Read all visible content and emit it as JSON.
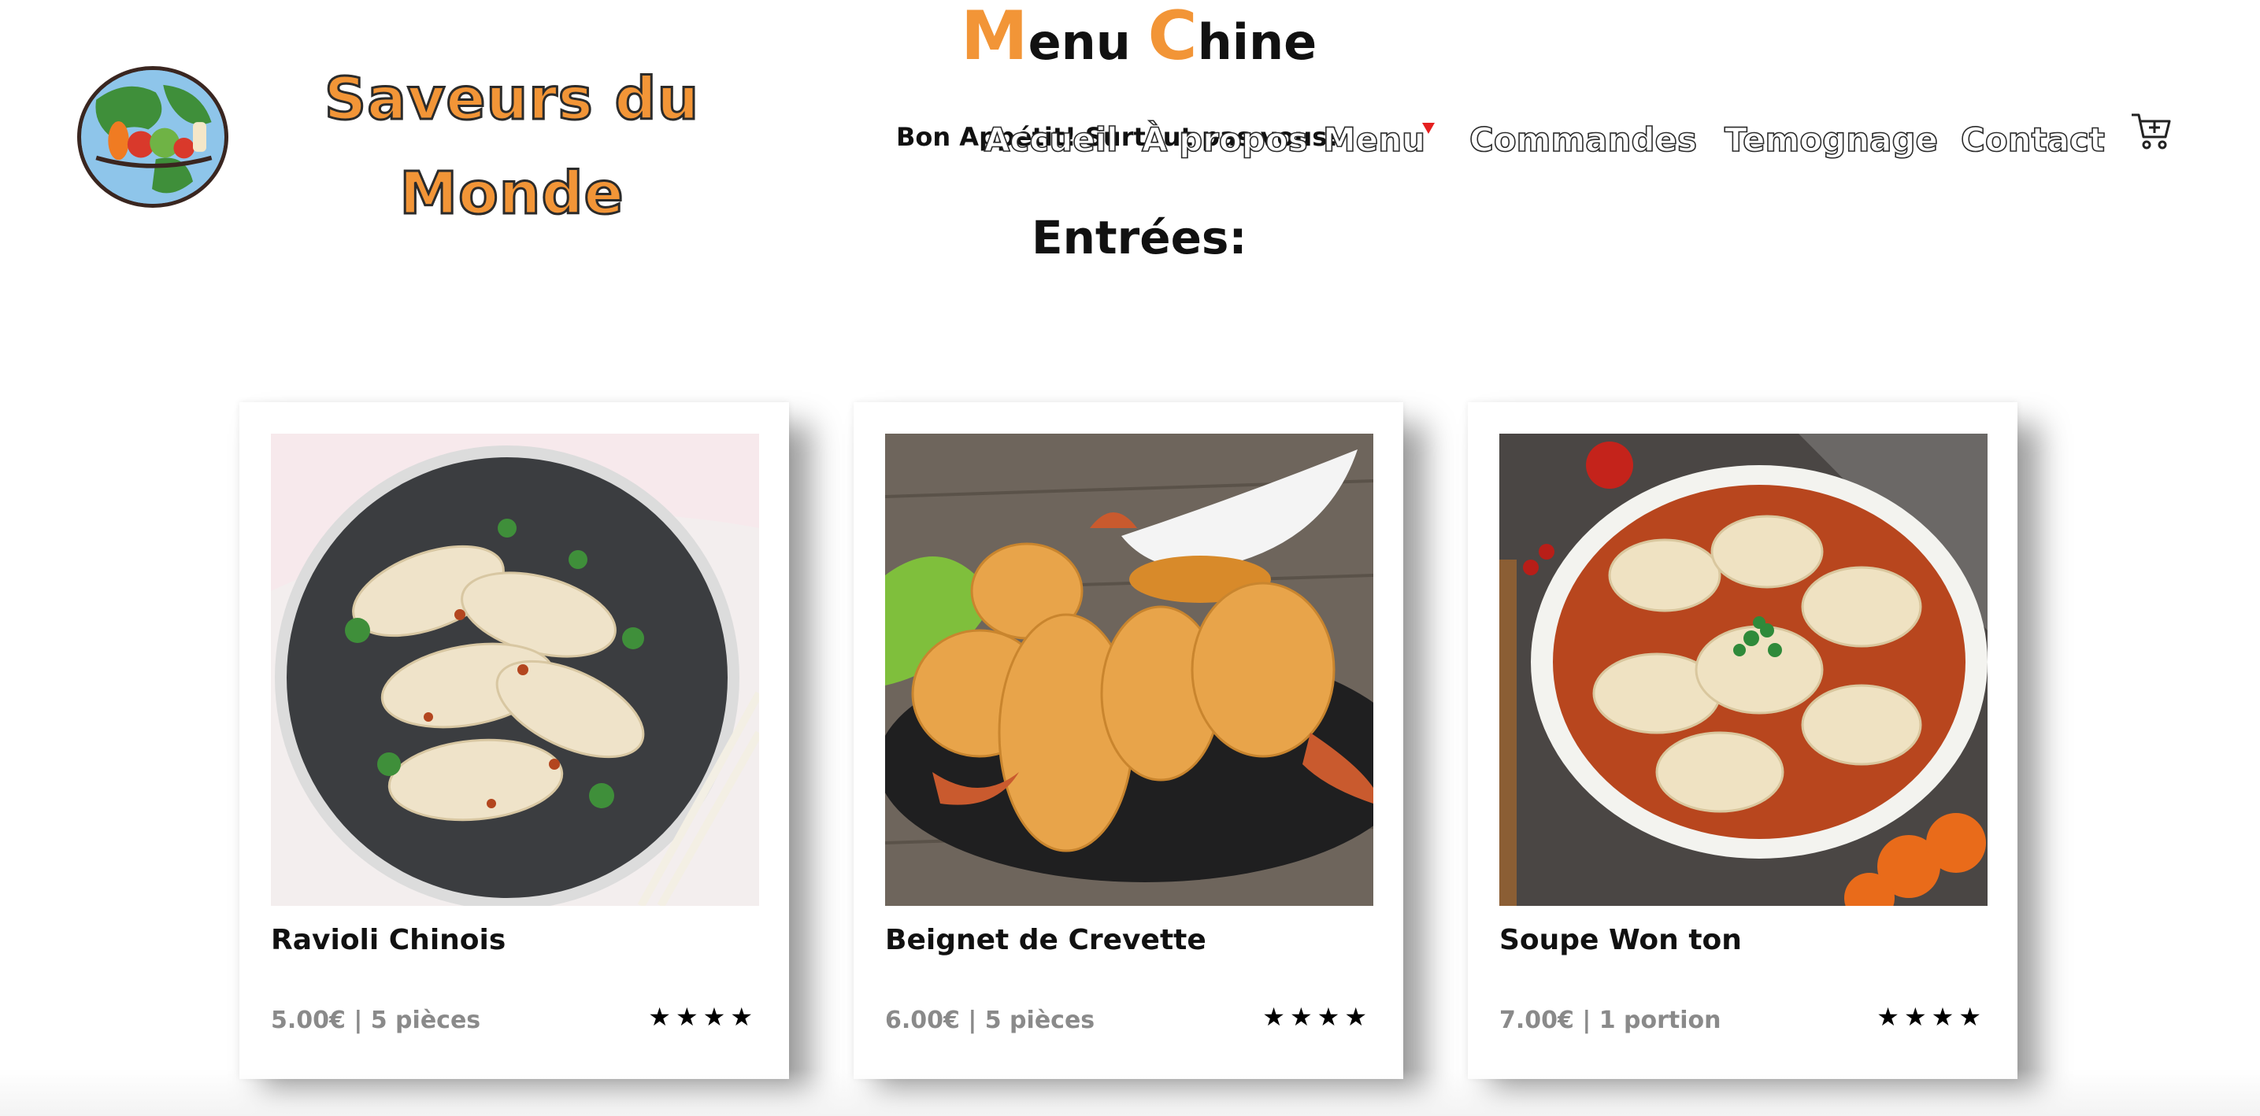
{
  "brand": {
    "line1": "Saveurs du",
    "line2": "Monde",
    "color": "#f29537"
  },
  "page_title": {
    "m_cap": "M",
    "m_rest": "enu ",
    "c_cap": "C",
    "c_rest": "hine"
  },
  "greeting": "Bon Appétit! Surtout pas vous!",
  "nav": {
    "accueil": "Accueil",
    "apropos": "À propos",
    "menu": "Menu",
    "commandes": "Commandes",
    "temoignage": "Temognage",
    "contact": "Contact",
    "cart_icon": "cart-icon",
    "caret_color": "#e51f1f"
  },
  "section_title": "Entrées:",
  "cards": [
    {
      "name": "Ravioli Chinois",
      "meta": "5.00€ | 5 pièces",
      "rating": 4,
      "stars": "★★★★"
    },
    {
      "name": "Beignet de Crevette",
      "meta": "6.00€ | 5 pièces",
      "rating": 4,
      "stars": "★★★★"
    },
    {
      "name": "Soupe Won ton",
      "meta": "7.00€ | 1 portion",
      "rating": 4,
      "stars": "★★★★"
    }
  ]
}
